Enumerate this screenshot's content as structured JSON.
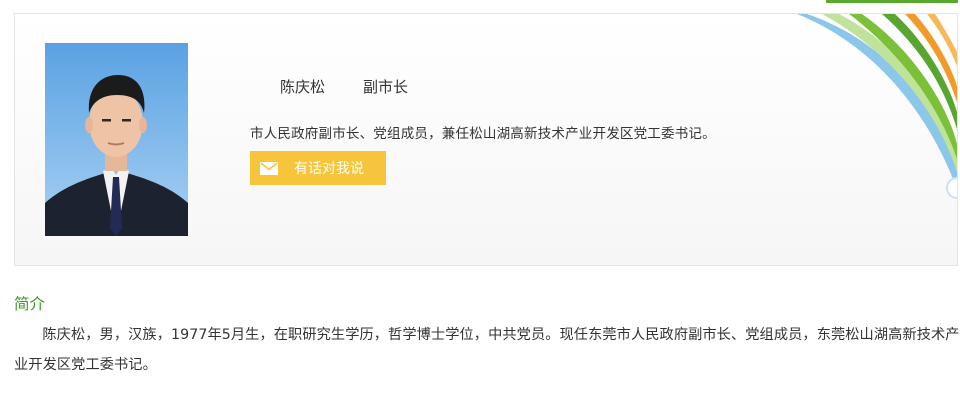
{
  "profile": {
    "name": "陈庆松",
    "position": "副市长",
    "duties": "市人民政府副市长、党组成员，兼任松山湖高新技术产业开发区党工委书记。",
    "message_button_label": "有话对我说",
    "message_icon": "mail-icon"
  },
  "intro": {
    "title": "简介",
    "text": "陈庆松，男，汉族，1977年5月生，在职研究生学历，哲学博士学位，中共党员。现任东莞市人民政府副市长、党组成员，东莞松山湖高新技术产业开发区党工委书记。"
  },
  "colors": {
    "accent_green": "#3c9a26",
    "button_yellow": "#f7c53b",
    "deco_blue": "#8cc7ea",
    "deco_green": "#7cc03a",
    "deco_orange": "#f29a28"
  }
}
